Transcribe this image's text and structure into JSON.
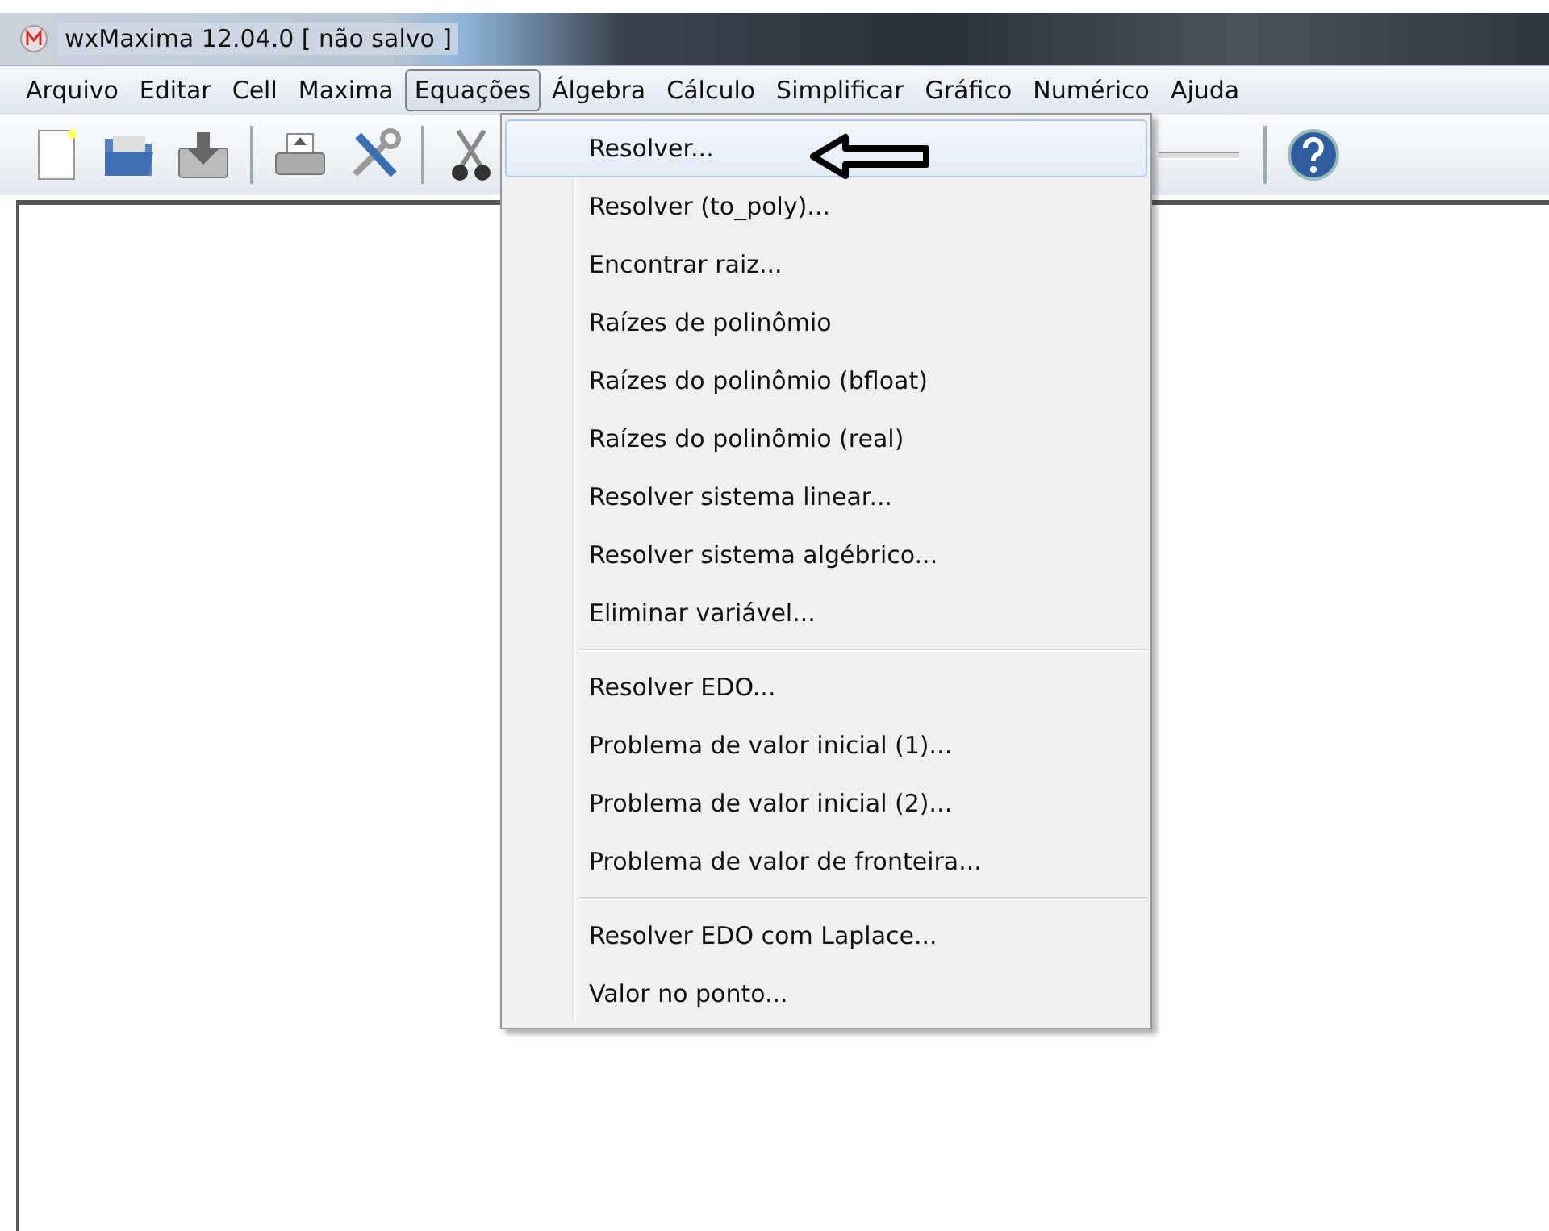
{
  "window": {
    "title": "wxMaxima 12.04.0 [ não salvo ]"
  },
  "menubar": [
    {
      "label": "Arquivo",
      "selected": false
    },
    {
      "label": "Editar",
      "selected": false
    },
    {
      "label": "Cell",
      "selected": false
    },
    {
      "label": "Maxima",
      "selected": false
    },
    {
      "label": "Equações",
      "selected": true
    },
    {
      "label": "Álgebra",
      "selected": false
    },
    {
      "label": "Cálculo",
      "selected": false
    },
    {
      "label": "Simplificar",
      "selected": false
    },
    {
      "label": "Gráfico",
      "selected": false
    },
    {
      "label": "Numérico",
      "selected": false
    },
    {
      "label": "Ajuda",
      "selected": false
    }
  ],
  "toolbar": [
    {
      "kind": "new"
    },
    {
      "kind": "open"
    },
    {
      "kind": "save"
    },
    {
      "kind": "separator"
    },
    {
      "kind": "print"
    },
    {
      "kind": "settings"
    },
    {
      "kind": "separator"
    },
    {
      "kind": "cut"
    },
    {
      "kind": "slider"
    },
    {
      "kind": "separator"
    },
    {
      "kind": "help"
    }
  ],
  "menu": {
    "items": [
      {
        "kind": "item",
        "label": "Resolver...",
        "selected": true
      },
      {
        "kind": "item",
        "label": "Resolver (to_poly)...",
        "selected": false
      },
      {
        "kind": "item",
        "label": "Encontrar raiz...",
        "selected": false
      },
      {
        "kind": "item",
        "label": "Raízes de polinômio",
        "selected": false
      },
      {
        "kind": "item",
        "label": "Raízes do polinômio (bfloat)",
        "selected": false
      },
      {
        "kind": "item",
        "label": "Raízes do polinômio (real)",
        "selected": false
      },
      {
        "kind": "item",
        "label": "Resolver sistema linear...",
        "selected": false
      },
      {
        "kind": "item",
        "label": "Resolver sistema algébrico...",
        "selected": false
      },
      {
        "kind": "item",
        "label": "Eliminar variável...",
        "selected": false
      },
      {
        "kind": "separator"
      },
      {
        "kind": "item",
        "label": "Resolver EDO...",
        "selected": false
      },
      {
        "kind": "item",
        "label": "Problema de valor inicial (1)...",
        "selected": false
      },
      {
        "kind": "item",
        "label": "Problema de valor inicial (2)...",
        "selected": false
      },
      {
        "kind": "item",
        "label": "Problema de valor de fronteira...",
        "selected": false
      },
      {
        "kind": "separator"
      },
      {
        "kind": "item",
        "label": "Resolver EDO com Laplace...",
        "selected": false
      },
      {
        "kind": "item",
        "label": "Valor no ponto...",
        "selected": false
      }
    ]
  }
}
